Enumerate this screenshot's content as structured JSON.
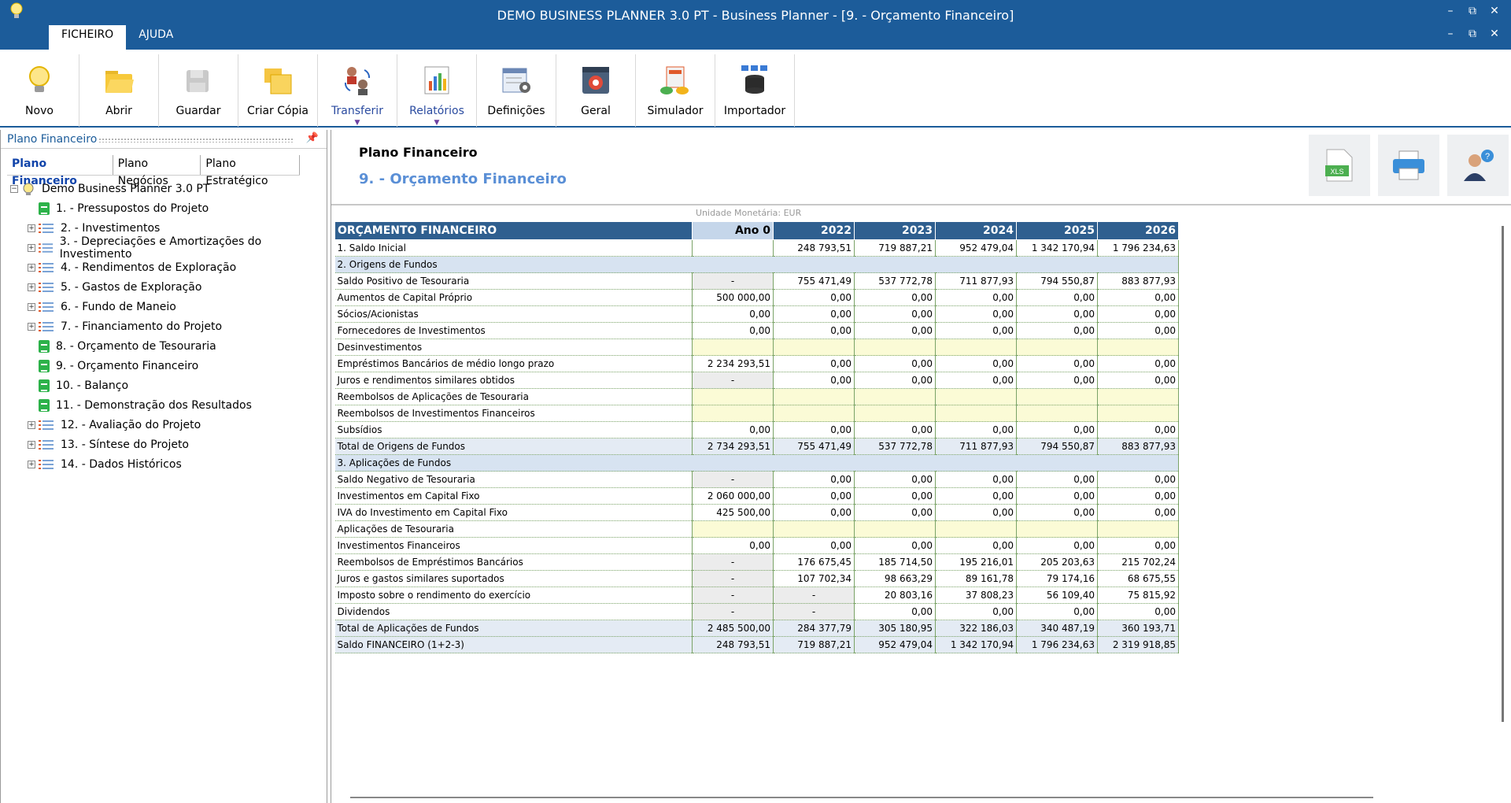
{
  "window": {
    "title": "DEMO BUSINESS PLANNER 3.0 PT - Business Planner - [9. - Orçamento Financeiro]",
    "controls": [
      "–",
      "⧉",
      "✕"
    ]
  },
  "menu_tabs": [
    {
      "label": "FICHEIRO",
      "active": true
    },
    {
      "label": "AJUDA",
      "active": false
    }
  ],
  "ribbon": [
    {
      "label": "Novo",
      "icon": "lightbulb-icon"
    },
    {
      "label": "Abrir",
      "icon": "folder-open-icon"
    },
    {
      "label": "Guardar",
      "icon": "save-icon"
    },
    {
      "label": "Criar Cópia",
      "icon": "copy-icon"
    },
    {
      "label": "Transferir",
      "icon": "transfer-icon",
      "dropdown": true
    },
    {
      "label": "Relatórios",
      "icon": "reports-icon",
      "dropdown": true
    },
    {
      "label": "Definições",
      "icon": "settings-sheet-icon"
    },
    {
      "label": "Geral",
      "icon": "gear-window-icon"
    },
    {
      "label": "Simulador",
      "icon": "simulator-icon"
    },
    {
      "label": "Importador",
      "icon": "database-import-icon"
    }
  ],
  "left_panel": {
    "title": "Plano Financeiro",
    "tabs": [
      {
        "label": "Plano Financeiro",
        "active": true
      },
      {
        "label": "Plano Negócios",
        "active": false
      },
      {
        "label": "Plano Estratégico",
        "active": false
      }
    ],
    "root": "Demo Business Planner 3.0 PT",
    "items": [
      {
        "label": "1. - Pressupostos do Projeto",
        "type": "doc",
        "expandable": false
      },
      {
        "label": "2. - Investimentos",
        "type": "list",
        "expandable": true
      },
      {
        "label": "3. - Depreciações e Amortizações do Investimento",
        "type": "list",
        "expandable": true
      },
      {
        "label": "4. - Rendimentos de Exploração",
        "type": "list",
        "expandable": true
      },
      {
        "label": "5. - Gastos de Exploração",
        "type": "list",
        "expandable": true
      },
      {
        "label": "6. - Fundo de Maneio",
        "type": "list",
        "expandable": true
      },
      {
        "label": "7. - Financiamento do Projeto",
        "type": "list",
        "expandable": true
      },
      {
        "label": "8. - Orçamento de Tesouraria",
        "type": "doc",
        "expandable": false
      },
      {
        "label": "9. - Orçamento Financeiro",
        "type": "doc",
        "expandable": false
      },
      {
        "label": "10. - Balanço",
        "type": "doc",
        "expandable": false
      },
      {
        "label": "11. - Demonstração dos Resultados",
        "type": "doc",
        "expandable": false
      },
      {
        "label": "12. - Avaliação do Projeto",
        "type": "list",
        "expandable": true
      },
      {
        "label": "13. - Síntese do Projeto",
        "type": "list",
        "expandable": true
      },
      {
        "label": "14. - Dados Históricos",
        "type": "list",
        "expandable": true
      }
    ]
  },
  "header": {
    "subtitle": "Plano Financeiro",
    "title": "9. - Orçamento Financeiro",
    "buttons": [
      {
        "name": "xls-export-button",
        "label": "XLS"
      },
      {
        "name": "print-button",
        "label": ""
      },
      {
        "name": "help-button",
        "label": "?"
      }
    ]
  },
  "unit_label": "Unidade Monetária: EUR",
  "table": {
    "columns": [
      "ORÇAMENTO FINANCEIRO",
      "Ano 0",
      "2022",
      "2023",
      "2024",
      "2025",
      "2026"
    ],
    "rows": [
      {
        "kind": "line",
        "label": "1. Saldo Inicial",
        "cells": [
          {
            "v": ""
          },
          {
            "v": "248 793,51"
          },
          {
            "v": "719 887,21"
          },
          {
            "v": "952 479,04"
          },
          {
            "v": "1 342 170,94"
          },
          {
            "v": "1 796 234,63"
          }
        ]
      },
      {
        "kind": "sec",
        "label": "2. Origens de Fundos",
        "cells": []
      },
      {
        "kind": "line",
        "label": "Saldo Positivo de Tesouraria",
        "cells": [
          {
            "v": "-",
            "s": "grey"
          },
          {
            "v": "755 471,49"
          },
          {
            "v": "537 772,78"
          },
          {
            "v": "711 877,93"
          },
          {
            "v": "794 550,87"
          },
          {
            "v": "883 877,93"
          }
        ]
      },
      {
        "kind": "line",
        "label": "Aumentos de Capital Próprio",
        "cells": [
          {
            "v": "500 000,00"
          },
          {
            "v": "0,00"
          },
          {
            "v": "0,00"
          },
          {
            "v": "0,00"
          },
          {
            "v": "0,00"
          },
          {
            "v": "0,00"
          }
        ]
      },
      {
        "kind": "line",
        "label": "Sócios/Acionistas",
        "cells": [
          {
            "v": "0,00"
          },
          {
            "v": "0,00"
          },
          {
            "v": "0,00"
          },
          {
            "v": "0,00"
          },
          {
            "v": "0,00"
          },
          {
            "v": "0,00"
          }
        ]
      },
      {
        "kind": "line",
        "label": "Fornecedores de Investimentos",
        "cells": [
          {
            "v": "0,00"
          },
          {
            "v": "0,00"
          },
          {
            "v": "0,00"
          },
          {
            "v": "0,00"
          },
          {
            "v": "0,00"
          },
          {
            "v": "0,00"
          }
        ]
      },
      {
        "kind": "line",
        "label": "Desinvestimentos",
        "cells": [
          {
            "v": "",
            "s": "yellow"
          },
          {
            "v": "",
            "s": "yellow"
          },
          {
            "v": "",
            "s": "yellow"
          },
          {
            "v": "",
            "s": "yellow"
          },
          {
            "v": "",
            "s": "yellow"
          },
          {
            "v": "",
            "s": "yellow"
          }
        ]
      },
      {
        "kind": "line",
        "label": "Empréstimos Bancários de médio longo prazo",
        "cells": [
          {
            "v": "2 234 293,51"
          },
          {
            "v": "0,00"
          },
          {
            "v": "0,00"
          },
          {
            "v": "0,00"
          },
          {
            "v": "0,00"
          },
          {
            "v": "0,00"
          }
        ]
      },
      {
        "kind": "line",
        "label": "Juros e rendimentos similares obtidos",
        "cells": [
          {
            "v": "-",
            "s": "grey"
          },
          {
            "v": "0,00"
          },
          {
            "v": "0,00"
          },
          {
            "v": "0,00"
          },
          {
            "v": "0,00"
          },
          {
            "v": "0,00"
          }
        ]
      },
      {
        "kind": "line",
        "label": "Reembolsos de Aplicações de Tesouraria",
        "cells": [
          {
            "v": "",
            "s": "yellow"
          },
          {
            "v": "",
            "s": "yellow"
          },
          {
            "v": "",
            "s": "yellow"
          },
          {
            "v": "",
            "s": "yellow"
          },
          {
            "v": "",
            "s": "yellow"
          },
          {
            "v": "",
            "s": "yellow"
          }
        ]
      },
      {
        "kind": "line",
        "label": "Reembolsos de Investimentos Financeiros",
        "cells": [
          {
            "v": "",
            "s": "yellow"
          },
          {
            "v": "",
            "s": "yellow"
          },
          {
            "v": "",
            "s": "yellow"
          },
          {
            "v": "",
            "s": "yellow"
          },
          {
            "v": "",
            "s": "yellow"
          },
          {
            "v": "",
            "s": "yellow"
          }
        ]
      },
      {
        "kind": "line",
        "label": "Subsídios",
        "cells": [
          {
            "v": "0,00"
          },
          {
            "v": "0,00"
          },
          {
            "v": "0,00"
          },
          {
            "v": "0,00"
          },
          {
            "v": "0,00"
          },
          {
            "v": "0,00"
          }
        ]
      },
      {
        "kind": "tot",
        "label": "Total de Origens de Fundos",
        "cells": [
          {
            "v": "2 734 293,51"
          },
          {
            "v": "755 471,49"
          },
          {
            "v": "537 772,78"
          },
          {
            "v": "711 877,93"
          },
          {
            "v": "794 550,87"
          },
          {
            "v": "883 877,93"
          }
        ]
      },
      {
        "kind": "sec",
        "label": "3. Aplicações de Fundos",
        "cells": []
      },
      {
        "kind": "line",
        "label": "Saldo Negativo de Tesouraria",
        "cells": [
          {
            "v": "-",
            "s": "grey"
          },
          {
            "v": "0,00"
          },
          {
            "v": "0,00"
          },
          {
            "v": "0,00"
          },
          {
            "v": "0,00"
          },
          {
            "v": "0,00"
          }
        ]
      },
      {
        "kind": "line",
        "label": "Investimentos em Capital Fixo",
        "cells": [
          {
            "v": "2 060 000,00"
          },
          {
            "v": "0,00"
          },
          {
            "v": "0,00"
          },
          {
            "v": "0,00"
          },
          {
            "v": "0,00"
          },
          {
            "v": "0,00"
          }
        ]
      },
      {
        "kind": "line",
        "label": "IVA do Investimento em Capital Fixo",
        "cells": [
          {
            "v": "425 500,00"
          },
          {
            "v": "0,00"
          },
          {
            "v": "0,00"
          },
          {
            "v": "0,00"
          },
          {
            "v": "0,00"
          },
          {
            "v": "0,00"
          }
        ]
      },
      {
        "kind": "line",
        "label": "Aplicações de Tesouraria",
        "cells": [
          {
            "v": "",
            "s": "yellow"
          },
          {
            "v": "",
            "s": "yellow"
          },
          {
            "v": "",
            "s": "yellow"
          },
          {
            "v": "",
            "s": "yellow"
          },
          {
            "v": "",
            "s": "yellow"
          },
          {
            "v": "",
            "s": "yellow"
          }
        ]
      },
      {
        "kind": "line",
        "label": "Investimentos Financeiros",
        "cells": [
          {
            "v": "0,00"
          },
          {
            "v": "0,00"
          },
          {
            "v": "0,00"
          },
          {
            "v": "0,00"
          },
          {
            "v": "0,00"
          },
          {
            "v": "0,00"
          }
        ]
      },
      {
        "kind": "line",
        "label": "Reembolsos de Empréstimos Bancários",
        "cells": [
          {
            "v": "-",
            "s": "grey"
          },
          {
            "v": "176 675,45"
          },
          {
            "v": "185 714,50"
          },
          {
            "v": "195 216,01"
          },
          {
            "v": "205 203,63"
          },
          {
            "v": "215 702,24"
          }
        ]
      },
      {
        "kind": "line",
        "label": "Juros e gastos similares suportados",
        "cells": [
          {
            "v": "-",
            "s": "grey"
          },
          {
            "v": "107 702,34"
          },
          {
            "v": "98 663,29"
          },
          {
            "v": "89 161,78"
          },
          {
            "v": "79 174,16"
          },
          {
            "v": "68 675,55"
          }
        ]
      },
      {
        "kind": "line",
        "label": "Imposto sobre o rendimento do exercício",
        "cells": [
          {
            "v": "-",
            "s": "grey"
          },
          {
            "v": "-",
            "s": "grey"
          },
          {
            "v": "20 803,16"
          },
          {
            "v": "37 808,23"
          },
          {
            "v": "56 109,40"
          },
          {
            "v": "75 815,92"
          }
        ]
      },
      {
        "kind": "line",
        "label": "Dividendos",
        "cells": [
          {
            "v": "-",
            "s": "grey"
          },
          {
            "v": "-",
            "s": "grey"
          },
          {
            "v": "0,00"
          },
          {
            "v": "0,00"
          },
          {
            "v": "0,00"
          },
          {
            "v": "0,00"
          }
        ]
      },
      {
        "kind": "tot",
        "label": "Total de Aplicações de Fundos",
        "cells": [
          {
            "v": "2 485 500,00"
          },
          {
            "v": "284 377,79"
          },
          {
            "v": "305 180,95"
          },
          {
            "v": "322 186,03"
          },
          {
            "v": "340 487,19"
          },
          {
            "v": "360 193,71"
          }
        ]
      },
      {
        "kind": "tot",
        "label": "Saldo FINANCEIRO (1+2-3)",
        "cells": [
          {
            "v": "248 793,51"
          },
          {
            "v": "719 887,21"
          },
          {
            "v": "952 479,04"
          },
          {
            "v": "1 342 170,94"
          },
          {
            "v": "1 796 234,63"
          },
          {
            "v": "2 319 918,85"
          }
        ]
      }
    ]
  },
  "colors": {
    "titlebar": "#1c5c9a",
    "table_header": "#2f5f8f",
    "section_row": "#d7e3f1",
    "accent_title": "#5a8fd6"
  }
}
